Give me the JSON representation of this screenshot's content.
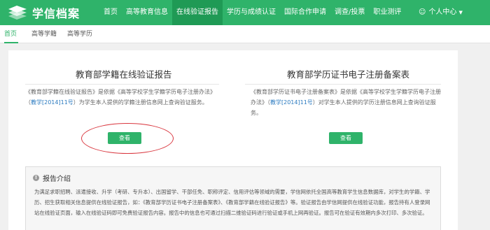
{
  "header": {
    "logo_text": "学信档案",
    "nav": [
      {
        "label": "首页",
        "active": false
      },
      {
        "label": "高等教育信息",
        "active": false
      },
      {
        "label": "在线验证报告",
        "active": true
      },
      {
        "label": "学历与成绩认证",
        "active": false
      },
      {
        "label": "国际合作申请",
        "active": false
      },
      {
        "label": "调查/投票",
        "active": false
      },
      {
        "label": "职业测评",
        "active": false
      }
    ],
    "user_menu_label": "个人中心"
  },
  "subnav": [
    {
      "label": "首页",
      "active": true
    },
    {
      "label": "高等学籍",
      "active": false
    },
    {
      "label": "高等学历",
      "active": false
    }
  ],
  "cards": [
    {
      "title": "教育部学籍在线验证报告",
      "desc_1": "《教育部学籍在线验证报告》是依据《高等学校学生学籍学历电子注册办法》（",
      "desc_link": "教学[2014]11号",
      "desc_2": "）为学生本人提供的学籍注册信息网上查询验证服务。",
      "button_label": "查看"
    },
    {
      "title": "教育部学历证书电子注册备案表",
      "desc_1": "《教育部学历证书电子注册备案表》是依据《高等学校学生学籍学历电子注册办法》（",
      "desc_link": "教学[2014]11号",
      "desc_2": "）对学生本人提供的学历注册信息网上查询验证服务。",
      "button_label": "查看"
    }
  ],
  "intro": {
    "title": "报告介绍",
    "text": "为满足求职招聘、派遣接收、升学（考研、专升本）、出国留学、干部任免、职称评定、信用评估等领域的需要，学信网依托全国高等教育学生信息数据库，对学生的学籍、学历、招生获取相关信息提供在线验证报告，如：《教育部学历证书电子注册备案表》、《教育部学籍在线验证报告》等。验证报告由学信网提供在线验证功能，报告持有人登录网站在线验证页面，输入在线验证码即可免费验证报告内容。报告中的信息也可通过扫描二维验证码进行验证或手机上网再验证。报告可在验证有效期内多次打印、多次验证。"
  },
  "colors": {
    "brand_green": "#2fb36a",
    "active_nav": "#1f9a55",
    "link_blue": "#2a7ac0",
    "annotation_red": "#d9363e"
  }
}
